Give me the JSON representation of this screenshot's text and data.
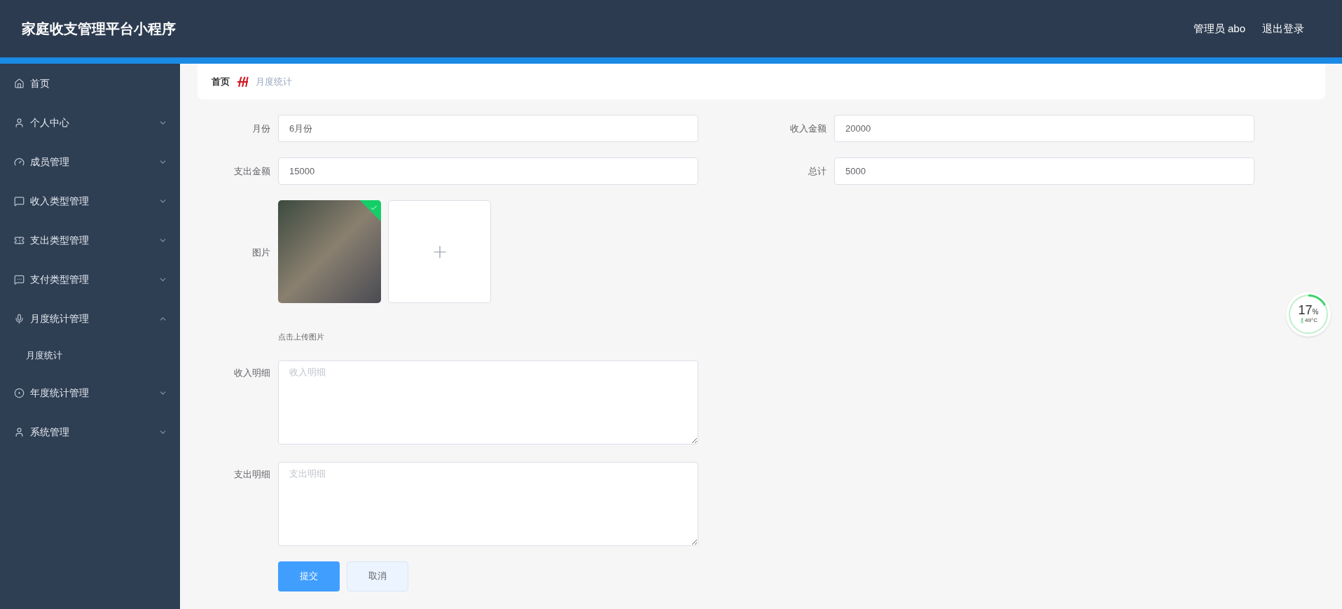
{
  "header": {
    "title": "家庭收支管理平台小程序",
    "user": "管理员 abo",
    "logout": "退出登录"
  },
  "sidebar": {
    "items": [
      {
        "label": "首页",
        "kind": "link"
      },
      {
        "label": "个人中心",
        "kind": "menu",
        "expanded": false
      },
      {
        "label": "成员管理",
        "kind": "menu",
        "expanded": false
      },
      {
        "label": "收入类型管理",
        "kind": "menu",
        "expanded": false
      },
      {
        "label": "支出类型管理",
        "kind": "menu",
        "expanded": false
      },
      {
        "label": "支付类型管理",
        "kind": "menu",
        "expanded": false
      },
      {
        "label": "月度统计管理",
        "kind": "menu",
        "expanded": true,
        "children": [
          {
            "label": "月度统计"
          }
        ]
      },
      {
        "label": "年度统计管理",
        "kind": "menu",
        "expanded": false
      },
      {
        "label": "系统管理",
        "kind": "menu",
        "expanded": false
      }
    ]
  },
  "breadcrumb": [
    "首页",
    "月度统计"
  ],
  "form": {
    "fields": [
      {
        "label": "月份",
        "value": "6月份"
      },
      {
        "label": "收入金额",
        "value": "20000"
      },
      {
        "label": "支出金额",
        "value": "15000"
      },
      {
        "label": "总计",
        "value": "5000"
      }
    ],
    "image": {
      "label": "图片",
      "uploaded": true,
      "hint": "点击上传图片"
    },
    "textareas": [
      {
        "label": "收入明细",
        "placeholder": "收入明细"
      },
      {
        "label": "支出明细",
        "placeholder": "支出明细"
      }
    ],
    "buttons": [
      {
        "label": "提交",
        "kind": "primary"
      },
      {
        "label": "取消",
        "kind": "default"
      }
    ]
  },
  "cpu_widget": {
    "reading": "17",
    "unit": "%",
    "temperature": "49°C"
  }
}
